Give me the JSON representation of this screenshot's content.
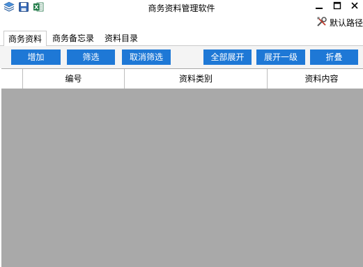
{
  "window": {
    "title": "商务资料管理软件",
    "quick_access_icons": [
      "layers-icon",
      "save-icon",
      "excel-icon"
    ],
    "controls": [
      "minimize-icon",
      "maximize-icon",
      "close-icon"
    ]
  },
  "toolbar_right": {
    "default_path_label": "默认路径",
    "icon": "tools-icon"
  },
  "tabs": [
    {
      "label": "商务资料",
      "active": true
    },
    {
      "label": "商务备忘录",
      "active": false
    },
    {
      "label": "资料目录",
      "active": false
    }
  ],
  "buttons": {
    "add": "增加",
    "filter": "筛选",
    "cancel_filter": "取消筛选",
    "expand_all": "全部展开",
    "expand_one_level": "展开一级",
    "collapse": "折叠"
  },
  "grid": {
    "columns": [
      "",
      "编号",
      "资料类别",
      "资料内容"
    ],
    "rows": []
  },
  "colors": {
    "button_bg": "#1e78d6",
    "button_text": "#ffffff",
    "grid_body_bg": "#a9a9a9",
    "toolbar_bg": "#f4f4f4"
  }
}
